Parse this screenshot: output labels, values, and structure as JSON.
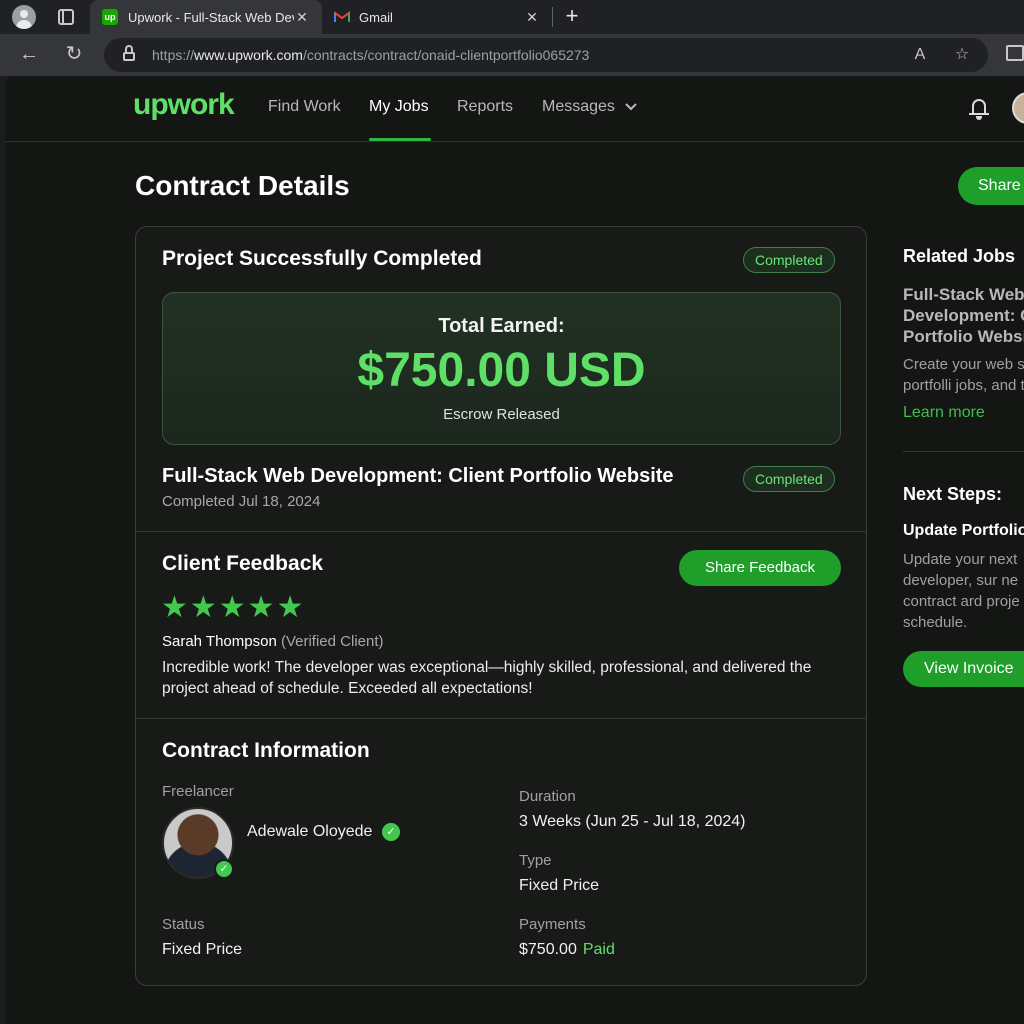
{
  "browser": {
    "tabs": [
      {
        "title": "Upwork - Full-Stack Web Dev",
        "favicon": "up"
      },
      {
        "title": "Gmail"
      }
    ],
    "url_prefix": "https://",
    "url_host": "www.upwork.com",
    "url_path": "/contracts/contract/onaid-clientportfolio065273"
  },
  "site": {
    "logo": "upwork",
    "nav": [
      "Find Work",
      "My Jobs",
      "Reports",
      "Messages"
    ],
    "active_nav": "My Jobs"
  },
  "page": {
    "title": "Contract Details",
    "share_label": "Share"
  },
  "summary": {
    "title": "Project Successfully Completed",
    "badge": "Completed",
    "earned_label": "Total Earned:",
    "earned_amount": "$750.00 USD",
    "earned_status": "Escrow Released",
    "job_title": "Full-Stack Web Development: Client Portfolio Website",
    "job_badge": "Completed",
    "job_date": "Completed Jul 18, 2024"
  },
  "feedback": {
    "title": "Client Feedback",
    "button": "Share Feedback",
    "stars": "★★★★★",
    "rating": 5,
    "reviewer": "Sarah Thompson",
    "reviewer_tag": "(Verified Client)",
    "text": "Incredible work! The developer was exceptional—highly skilled, professional, and delivered the project ahead of schedule. Exceeded all expectations!"
  },
  "contract": {
    "title": "Contract Information",
    "freelancer_label": "Freelancer",
    "freelancer_name": "Adewale Oloyede",
    "duration_label": "Duration",
    "duration_value": "3 Weeks (Jun 25 - Jul 18, 2024)",
    "type_label": "Type",
    "type_value": "Fixed Price",
    "status_label": "Status",
    "status_value": "Fixed Price",
    "payments_label": "Payments",
    "payments_value": "$750.00",
    "payments_status": "Paid"
  },
  "sidebar": {
    "related_title": "Related Jobs",
    "related_job_line1": "Full-Stack Web",
    "related_job_line2": "Development: C",
    "related_job_line3": "Portfolio Websit",
    "related_desc_line1": "Create your web si",
    "related_desc_line2": "portfolli jobs, and t",
    "learn_more": "Learn more",
    "next_title": "Next Steps:",
    "next_sub": "Update Portfolio",
    "next_line1": "Update your next",
    "next_line2": "developer, sur ne",
    "next_line3": "contract ard proje",
    "next_line4": "schedule.",
    "invoice_button": "View Invoice"
  },
  "colors": {
    "accent": "#5ee067",
    "button": "#1f9e2a",
    "background": "#141614"
  }
}
